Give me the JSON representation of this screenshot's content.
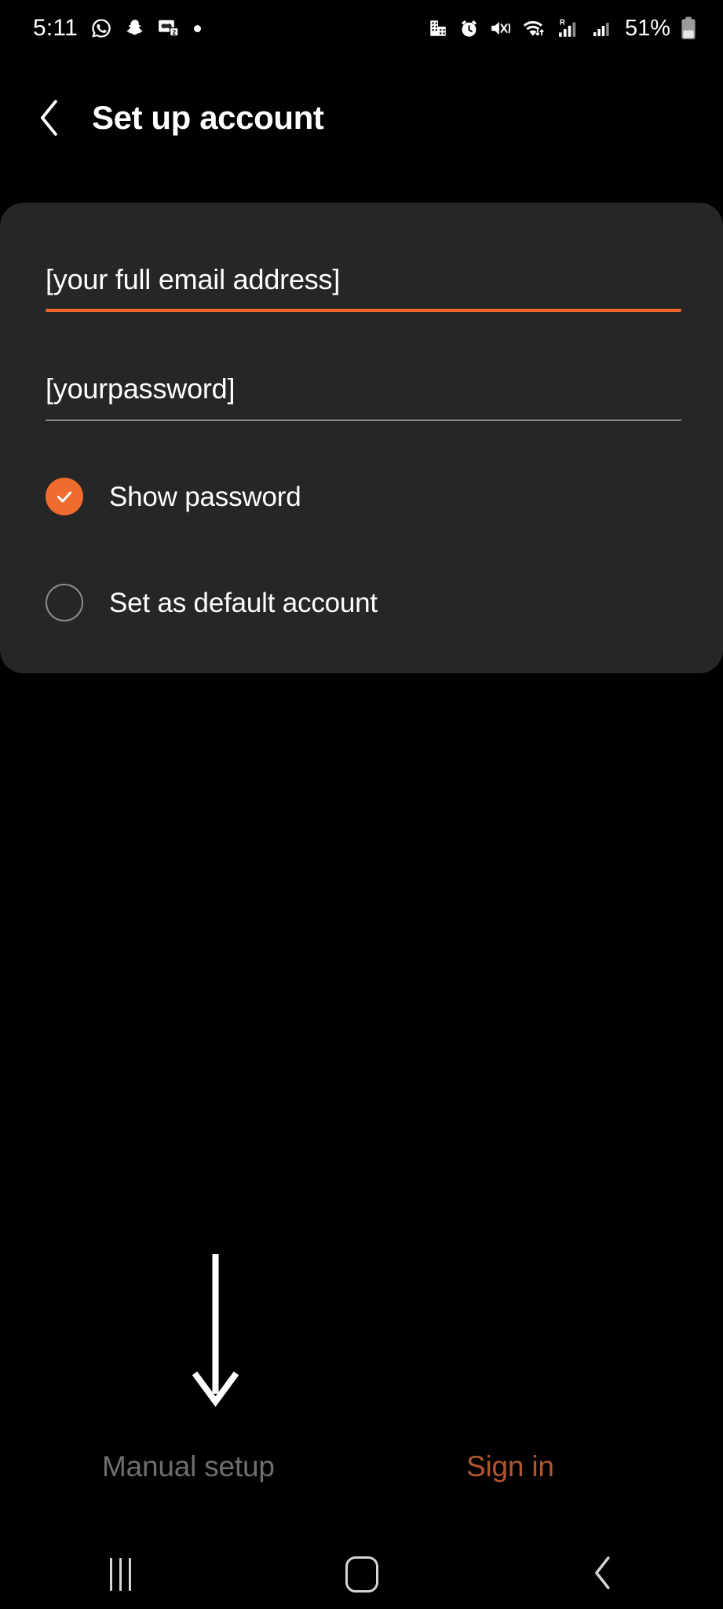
{
  "status_bar": {
    "time": "5:11",
    "left_icons": [
      {
        "name": "whatsapp-icon"
      },
      {
        "name": "snapchat-icon"
      },
      {
        "name": "voicemail-icon"
      },
      {
        "name": "notification-dot-icon"
      }
    ],
    "right_icons": [
      {
        "name": "work-profile-icon"
      },
      {
        "name": "alarm-icon"
      },
      {
        "name": "sound-vibrate-off-icon"
      },
      {
        "name": "wifi-icon"
      },
      {
        "name": "roaming-signal-icon"
      },
      {
        "name": "signal-bars-icon"
      }
    ],
    "battery_percent": "51%",
    "battery_level": 51
  },
  "header": {
    "back_label": "back",
    "title": "Set up account"
  },
  "form": {
    "email": {
      "value": "[your full email address]",
      "placeholder": "Email address",
      "focused": true,
      "underline_color": "#f0652b"
    },
    "password": {
      "value": "[yourpassword]",
      "placeholder": "Password",
      "focused": false,
      "underline_color": "#8e8e8e"
    },
    "options": [
      {
        "id": "show-password",
        "label": "Show password",
        "checked": true,
        "accent": "#ef6c2e"
      },
      {
        "id": "set-as-default-account",
        "label": "Set as default account",
        "checked": false,
        "accent": "#8b8b8b"
      }
    ]
  },
  "annotation": {
    "arrow": "down-arrow pointing to Manual setup",
    "color": "#ffffff"
  },
  "bottom_actions": {
    "manual_setup": {
      "label": "Manual setup",
      "color": "#6e6e6e"
    },
    "sign_in": {
      "label": "Sign in",
      "color": "#b1552f"
    }
  },
  "nav_bar": {
    "recents": "recents",
    "home": "home",
    "back": "back"
  },
  "colors": {
    "background": "#000000",
    "card": "#262626",
    "accent_orange": "#f0652b",
    "text_primary": "#ffffff",
    "text_muted": "#6e6e6e"
  }
}
